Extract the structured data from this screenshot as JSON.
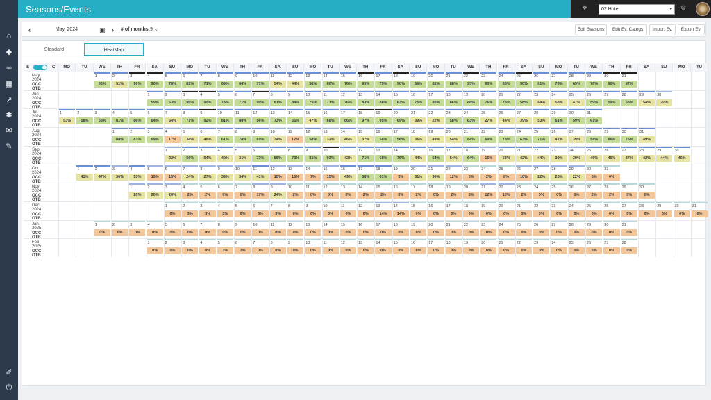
{
  "page_title": "Seasons/Events",
  "hotel_select": "02 Hotel",
  "toolbar": {
    "date": "May, 2024",
    "months_label": "# of months:",
    "months_value": "9",
    "buttons": [
      "Edit Seasons",
      "Edit Ev. Categs.",
      "Import Ev.",
      "Export Ev."
    ]
  },
  "tabs": [
    "Standard",
    "HeatMap"
  ],
  "toggle": {
    "left": "S",
    "right": "C"
  },
  "weekdays": [
    "MO",
    "TU",
    "WE",
    "TH",
    "FR",
    "SA",
    "SU",
    "MO",
    "TU",
    "WE",
    "TH",
    "FR",
    "SA",
    "SU",
    "MO",
    "TU",
    "WE",
    "TH",
    "FR",
    "SA",
    "SU",
    "MO",
    "TU",
    "WE",
    "TH",
    "FR",
    "SA",
    "SU",
    "MO",
    "TU",
    "WE",
    "TH",
    "FR",
    "SA",
    "SU",
    "MO",
    "TU"
  ],
  "row_sub_label": "OCC OTB",
  "months": [
    {
      "label": "May 2024",
      "start": 2,
      "occ": [
        "63%",
        "51%",
        "90%",
        "90%",
        "78%",
        "81%",
        "71%",
        "69%",
        "64%",
        "71%",
        "54%",
        "44%",
        "58%",
        "80%",
        "76%",
        "95%",
        "75%",
        "90%",
        "56%",
        "81%",
        "88%",
        "93%",
        "80%",
        "85%",
        "90%",
        "81%",
        "76%",
        "69%",
        "76%",
        "90%",
        "97%"
      ]
    },
    {
      "label": "Jun 2024",
      "start": 5,
      "occ": [
        "59%",
        "63%",
        "95%",
        "90%",
        "73%",
        "71%",
        "90%",
        "81%",
        "84%",
        "75%",
        "71%",
        "76%",
        "83%",
        "88%",
        "63%",
        "75%",
        "85%",
        "86%",
        "86%",
        "76%",
        "73%",
        "58%",
        "44%",
        "53%",
        "47%",
        "59%",
        "59%",
        "63%",
        "54%",
        "20%"
      ]
    },
    {
      "label": "Jul 2024",
      "start": 0,
      "occ": [
        "53%",
        "58%",
        "68%",
        "81%",
        "86%",
        "64%",
        "54%",
        "71%",
        "92%",
        "81%",
        "88%",
        "56%",
        "73%",
        "56%",
        "47%",
        "68%",
        "86%",
        "97%",
        "95%",
        "69%",
        "39%",
        "22%",
        "58%",
        "63%",
        "27%",
        "44%",
        "39%",
        "53%",
        "61%",
        "59%",
        "61%"
      ]
    },
    {
      "label": "Aug 2024",
      "start": 3,
      "occ": [
        "88%",
        "83%",
        "69%",
        "17%",
        "34%",
        "46%",
        "61%",
        "78%",
        "69%",
        "34%",
        "12%",
        "58%",
        "32%",
        "46%",
        "37%",
        "58%",
        "56%",
        "36%",
        "49%",
        "54%",
        "64%",
        "69%",
        "78%",
        "63%",
        "71%",
        "41%",
        "39%",
        "58%",
        "66%",
        "76%",
        "49%"
      ]
    },
    {
      "label": "Sep 2024",
      "start": 6,
      "occ": [
        "22%",
        "56%",
        "54%",
        "49%",
        "31%",
        "73%",
        "56%",
        "73%",
        "81%",
        "93%",
        "42%",
        "71%",
        "68%",
        "76%",
        "44%",
        "64%",
        "54%",
        "64%",
        "15%",
        "53%",
        "42%",
        "44%",
        "39%",
        "39%",
        "46%",
        "46%",
        "47%",
        "42%",
        "44%",
        "46%"
      ]
    },
    {
      "label": "Oct 2024",
      "start": 1,
      "occ": [
        "41%",
        "47%",
        "36%",
        "53%",
        "19%",
        "15%",
        "24%",
        "27%",
        "39%",
        "34%",
        "41%",
        "15%",
        "15%",
        "7%",
        "15%",
        "49%",
        "58%",
        "61%",
        "5%",
        "31%",
        "36%",
        "12%",
        "5%",
        "2%",
        "8%",
        "10%",
        "22%",
        "25%",
        "22%",
        "5%",
        "0%"
      ]
    },
    {
      "label": "Nov 2024",
      "start": 4,
      "occ": [
        "20%",
        "20%",
        "20%",
        "2%",
        "2%",
        "0%",
        "0%",
        "17%",
        "24%",
        "2%",
        "0%",
        "0%",
        "0%",
        "2%",
        "2%",
        "0%",
        "2%",
        "0%",
        "2%",
        "5%",
        "12%",
        "10%",
        "2%",
        "0%",
        "0%",
        "0%",
        "2%",
        "2%",
        "0%",
        "0%"
      ]
    },
    {
      "label": "Dec 2024",
      "start": 6,
      "occ": [
        "0%",
        "3%",
        "3%",
        "3%",
        "0%",
        "3%",
        "3%",
        "0%",
        "0%",
        "0%",
        "0%",
        "0%",
        "14%",
        "14%",
        "0%",
        "0%",
        "0%",
        "0%",
        "0%",
        "0%",
        "3%",
        "0%",
        "0%",
        "0%",
        "0%",
        "0%",
        "0%",
        "0%",
        "0%",
        "0%",
        "0%"
      ]
    },
    {
      "label": "Jan 2025",
      "start": 2,
      "occ": [
        "0%",
        "0%",
        "0%",
        "0%",
        "0%",
        "0%",
        "0%",
        "0%",
        "0%",
        "0%",
        "0%",
        "0%",
        "0%",
        "0%",
        "0%",
        "0%",
        "0%",
        "0%",
        "0%",
        "0%",
        "0%",
        "0%",
        "0%",
        "0%",
        "0%",
        "0%",
        "0%",
        "0%",
        "0%",
        "0%",
        "0%"
      ]
    },
    {
      "label": "Feb 2025",
      "start": 5,
      "occ": [
        "0%",
        "0%",
        "0%",
        "0%",
        "3%",
        "3%",
        "0%",
        "0%",
        "0%",
        "0%",
        "0%",
        "0%",
        "0%",
        "0%",
        "0%",
        "0%",
        "0%",
        "0%",
        "0%",
        "0%",
        "0%",
        "0%",
        "0%",
        "0%",
        "0%",
        "0%",
        "0%",
        "0%"
      ]
    }
  ],
  "colors": {
    "topbar": "#25aec5",
    "sidebar": "#2d3a4b",
    "high": "#c5dc96",
    "mid": "#e7e3a2",
    "low": "#f4c79a",
    "bar": "#6b8fd6"
  }
}
